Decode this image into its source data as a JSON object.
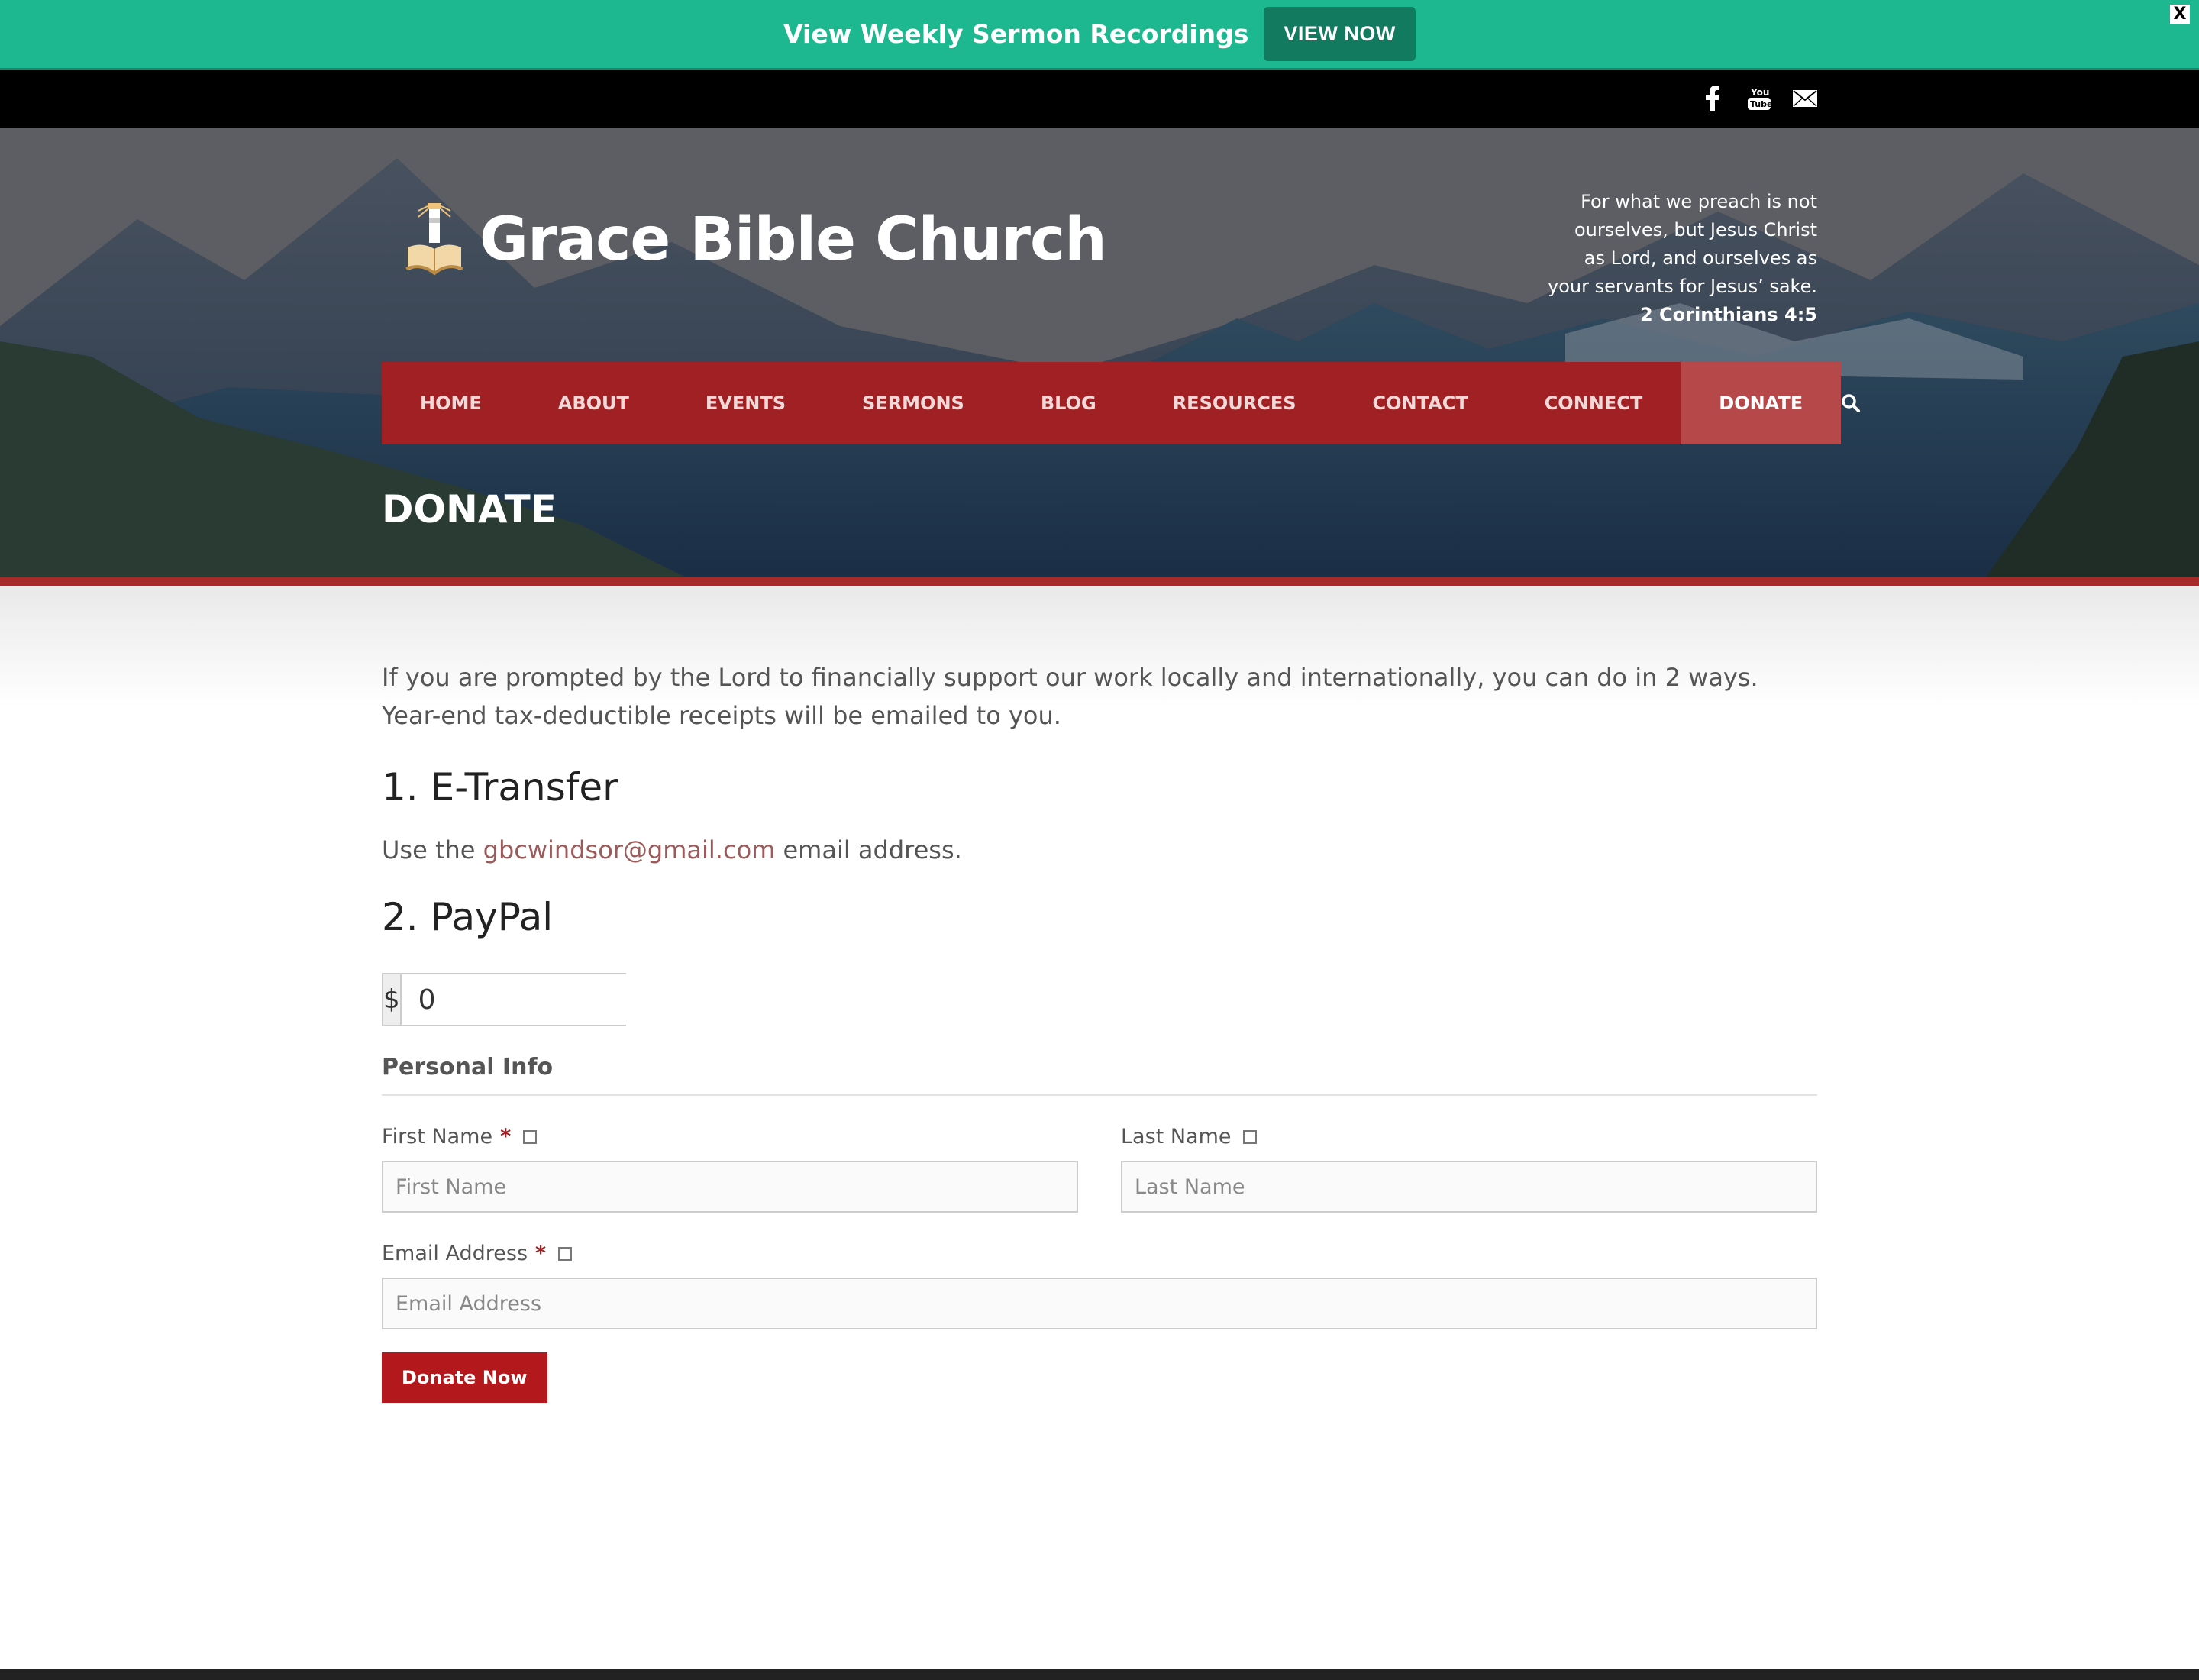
{
  "announcement": {
    "text": "View Weekly Sermon Recordings",
    "button_label": "VIEW NOW",
    "close_label": "X"
  },
  "social": [
    "facebook-icon",
    "youtube-icon",
    "mail-icon"
  ],
  "header": {
    "logo_text": "Grace Bible Church",
    "verse_lines": [
      "For what we preach is not",
      "ourselves, but Jesus Christ",
      "as Lord, and ourselves as",
      "your servants for Jesus’ sake."
    ],
    "verse_ref": "2 Corinthians 4:5"
  },
  "nav": {
    "items": [
      "HOME",
      "ABOUT",
      "EVENTS",
      "SERMONS",
      "BLOG",
      "RESOURCES",
      "CONTACT",
      "CONNECT",
      "DONATE"
    ],
    "active": "DONATE"
  },
  "page": {
    "title": "DONATE",
    "intro": "If you are prompted by the Lord to financially support our work locally and internationally, you can do in 2 ways. Year-end tax-deductible receipts will be emailed to you.",
    "etransfer_heading": "1. E-Transfer",
    "etransfer_pre": "Use the ",
    "etransfer_email": "gbcwindsor@gmail.com",
    "etransfer_post": " email address.",
    "paypal_heading": "2. PayPal"
  },
  "form": {
    "currency_symbol": "$",
    "amount_value": "0",
    "section_label": "Personal Info",
    "first_name_label": "First Name",
    "first_name_placeholder": "First Name",
    "last_name_label": "Last Name",
    "last_name_placeholder": "Last Name",
    "email_label": "Email Address",
    "email_placeholder": "Email Address",
    "required_mark": "*",
    "submit_label": "Donate Now"
  },
  "colors": {
    "announcement_bg": "#1db88f",
    "nav_bg": "#a02023",
    "button_bg": "#b3191c",
    "link": "#9c5a5a"
  }
}
